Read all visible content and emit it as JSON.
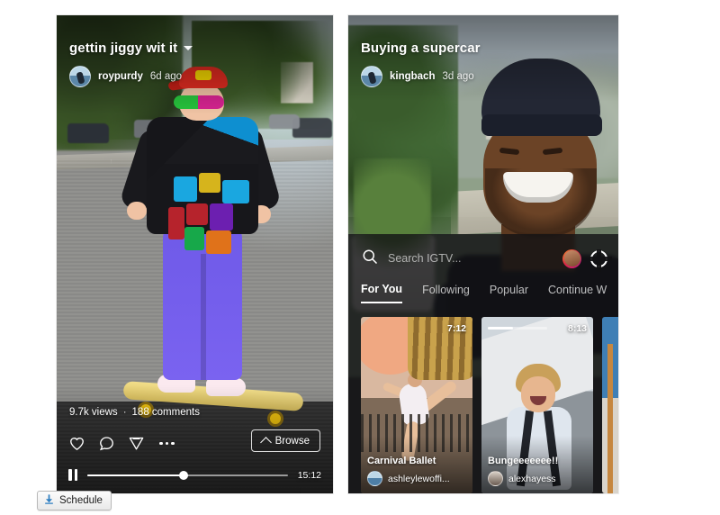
{
  "left_video": {
    "title": "gettin jiggy wit it",
    "caret_icon": "chevron-down-icon",
    "author": "roypurdy",
    "time_ago": "6d ago",
    "views": "9.7k views",
    "separator": "·",
    "comments": "188 comments",
    "actions": [
      "heart-icon",
      "comment-icon",
      "send-icon",
      "more-options-icon"
    ],
    "browse_label": "Browse",
    "duration": "15:12",
    "progress_percent": 48,
    "playback_state": "playing"
  },
  "right_video": {
    "title": "Buying a supercar",
    "author": "kingbach",
    "time_ago": "3d ago"
  },
  "igtv": {
    "search_placeholder": "Search IGTV...",
    "search_icon": "search-icon",
    "profile_icon": "profile-avatar-icon",
    "igtv_icon": "igtv-circle-icon",
    "tabs": [
      {
        "label": "For You",
        "active": true
      },
      {
        "label": "Following",
        "active": false
      },
      {
        "label": "Popular",
        "active": false
      },
      {
        "label": "Continue W",
        "active": false
      }
    ],
    "cards": [
      {
        "title": "Carnival Ballet",
        "user": "ashleylewoffi...",
        "duration": "7:12",
        "has_progress": false
      },
      {
        "title": "Bungeeeeeee!!",
        "user": "alexhayess",
        "duration": "8:13",
        "has_progress": true
      },
      {
        "title": "",
        "user": "",
        "duration": "",
        "has_progress": false
      }
    ]
  },
  "toolbar": {
    "schedule_label": "Schedule",
    "schedule_icon": "download-arrow-icon"
  },
  "colors": {
    "accent": "#ffffff",
    "sheet_bg": "#121214",
    "page_bg": "#ffffff"
  }
}
